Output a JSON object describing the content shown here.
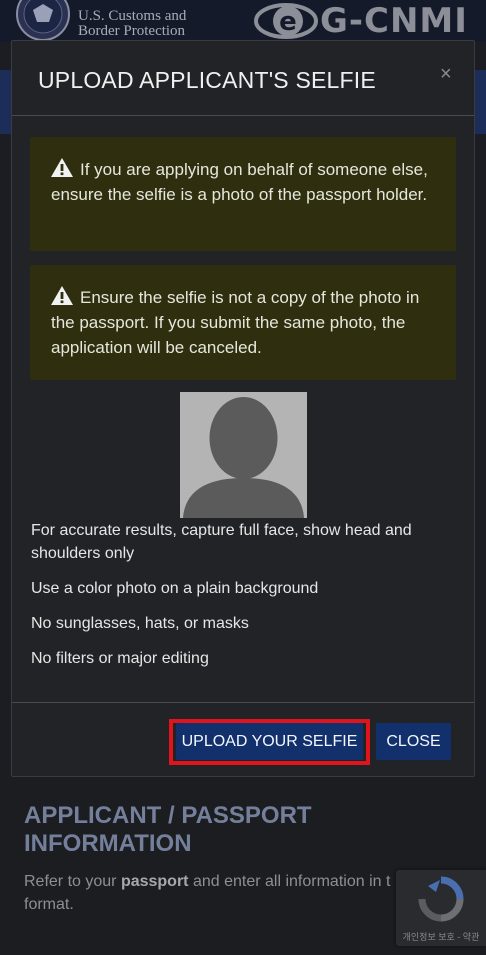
{
  "header": {
    "agency_line1": "U.S. Customs and",
    "agency_line2": "Border Protection",
    "logo_text": "G-CNMI"
  },
  "modal": {
    "title": "UPLOAD APPLICANT'S SELFIE",
    "close_x": "×",
    "alerts": [
      {
        "icon": "warning-icon",
        "text": "If you are applying on behalf of someone else, ensure the selfie is a photo of the passport holder."
      },
      {
        "icon": "warning-icon",
        "text": "Ensure the selfie is not a copy of the photo in the passport. If you submit the same photo, the application will be canceled."
      }
    ],
    "tips": [
      "For accurate results, capture full face, show head and shoulders only",
      "Use a color photo on a plain background",
      "No sunglasses, hats, or masks",
      "No filters or major editing"
    ],
    "upload_button": "UPLOAD YOUR SELFIE",
    "close_button": "CLOSE"
  },
  "background_page": {
    "section_title": "APPLICANT / PASSPORT INFORMATION",
    "para_prefix": "Refer to your ",
    "para_bold": "passport",
    "para_suffix": " and enter all information in t",
    "para_line2": "format."
  },
  "recaptcha": {
    "footer_text": "개인정보 보호 - 약관"
  },
  "colors": {
    "alert_bg": "#2f2f0f",
    "button_bg": "#12306b",
    "highlight": "#e0141c"
  }
}
